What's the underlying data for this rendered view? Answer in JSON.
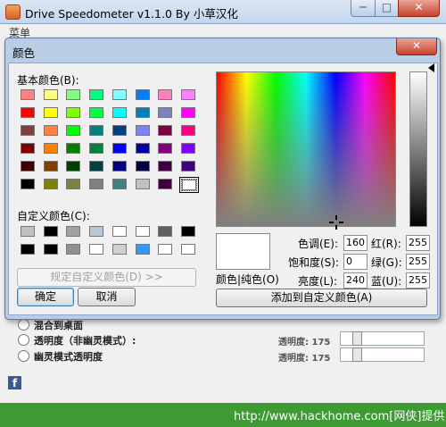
{
  "main": {
    "title": "Drive Speedometer v1.1.0 By 小草汉化",
    "menu_label": "菜单",
    "window_buttons": {
      "minimize": "─",
      "maximize": "□",
      "close": "✕"
    },
    "options": [
      {
        "label": "混合到桌面"
      },
      {
        "label": "透明度（非幽灵模式）:",
        "opacity_label": "透明度: 175"
      },
      {
        "label": "幽灵模式透明度",
        "opacity_label": "透明度: 175"
      }
    ],
    "facebook_glyph": "f",
    "watermark": "http://www.hackhome.com[网侠]提供"
  },
  "dialog": {
    "title": "颜色",
    "close_glyph": "✕",
    "basic_colors_label": "基本颜色(B):",
    "basic_colors": [
      [
        "#ff8080",
        "#ffff80",
        "#80ff80",
        "#00ff80",
        "#80ffff",
        "#0080ff",
        "#ff80c0",
        "#ff80ff"
      ],
      [
        "#ff0000",
        "#ffff00",
        "#80ff00",
        "#00ff40",
        "#00ffff",
        "#0080c0",
        "#8080c0",
        "#ff00ff"
      ],
      [
        "#804040",
        "#ff8040",
        "#00ff00",
        "#008080",
        "#004080",
        "#8080ff",
        "#800040",
        "#ff0080"
      ],
      [
        "#800000",
        "#ff8000",
        "#008000",
        "#008040",
        "#0000ff",
        "#0000a0",
        "#800080",
        "#8000ff"
      ],
      [
        "#400000",
        "#804000",
        "#004000",
        "#004040",
        "#000080",
        "#000040",
        "#400040",
        "#400080"
      ],
      [
        "#000000",
        "#808000",
        "#808040",
        "#808080",
        "#408080",
        "#c0c0c0",
        "#400040",
        "#ffffff"
      ]
    ],
    "custom_colors_label": "自定义颜色(C):",
    "custom_colors": [
      [
        "#c0c0c0",
        "#000000",
        "#a0a0a0",
        "#b8c8d8",
        "#ffffff",
        "#ffffff",
        "#606060",
        "#000000"
      ],
      [
        "#000000",
        "#000000",
        "#909090",
        "#ffffff",
        "#d0d0d0",
        "#3399ff",
        "#ffffff",
        "#ffffff"
      ]
    ],
    "define_custom_button": "规定自定义颜色(D) >>",
    "ok_button": "确定",
    "cancel_button": "取消",
    "color_solid_label": "颜色|纯色(O)",
    "hue_label": "色调(E):",
    "hue_value": "160",
    "sat_label": "饱和度(S):",
    "sat_value": "0",
    "lum_label": "亮度(L):",
    "lum_value": "240",
    "red_label": "红(R):",
    "red_value": "255",
    "green_label": "绿(G):",
    "green_value": "255",
    "blue_label": "蓝(U):",
    "blue_value": "255",
    "add_custom_button": "添加到自定义颜色(A)"
  }
}
